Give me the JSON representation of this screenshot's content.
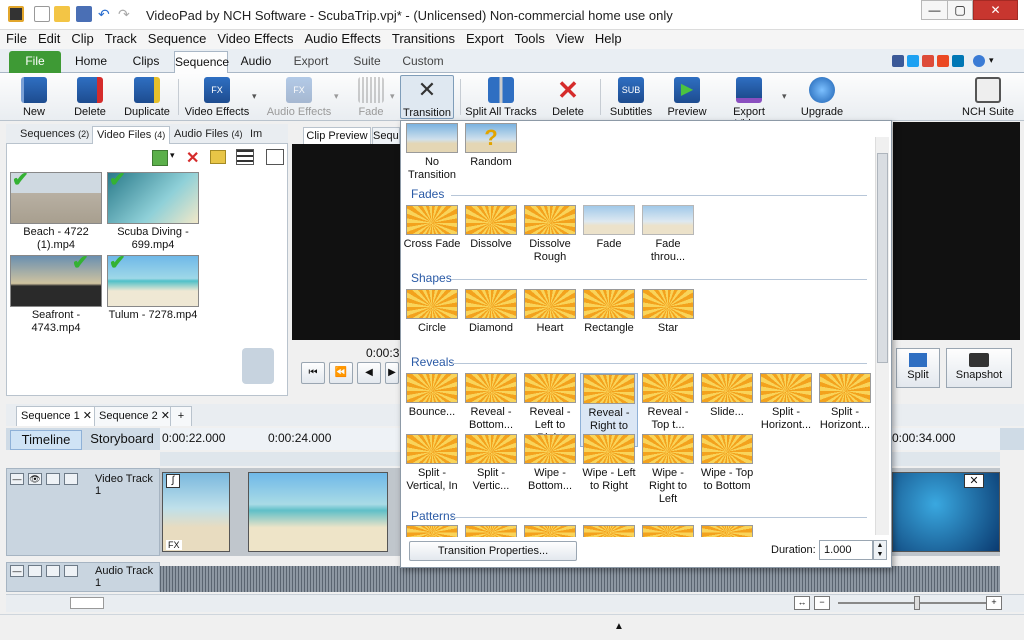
{
  "window": {
    "title": "VideoPad by NCH Software - ScubaTrip.vpj* - (Unlicensed) Non-commercial home use only",
    "minimize": "—",
    "maximize": "▢",
    "close": "✕"
  },
  "menu": [
    "File",
    "Edit",
    "Clip",
    "Track",
    "Sequence",
    "Video Effects",
    "Audio Effects",
    "Transitions",
    "Export",
    "Tools",
    "View",
    "Help"
  ],
  "ribbon_tabs": [
    "File",
    "Home",
    "Clips",
    "Sequence",
    "Audio",
    "Export",
    "Suite",
    "Custom"
  ],
  "toolbar": {
    "new": "New",
    "delete": "Delete",
    "duplicate": "Duplicate",
    "video_effects": "Video Effects",
    "audio_effects": "Audio Effects",
    "fade": "Fade",
    "transition": "Transition",
    "split_all_tracks": "Split All Tracks",
    "delete2": "Delete",
    "subtitles": "Subtitles",
    "preview": "Preview",
    "export_video": "Export Video",
    "upgrade": "Upgrade",
    "nch_suite": "NCH Suite",
    "sub_badge": "SUB",
    "fx_badge": "FX"
  },
  "bin": {
    "tabs": [
      {
        "label": "Sequences",
        "count": "(2)"
      },
      {
        "label": "Video Files",
        "count": "(4)"
      },
      {
        "label": "Audio Files",
        "count": "(4)"
      },
      {
        "label": "Im",
        "count": ""
      }
    ],
    "files": [
      {
        "name": "Beach - 4722 (1).mp4"
      },
      {
        "name": "Scuba Diving - 699.mp4"
      },
      {
        "name": "Seafront - 4743.mp4"
      },
      {
        "name": "Tulum - 7278.mp4"
      }
    ]
  },
  "preview": {
    "tab_clip": "Clip Preview",
    "tab_seq": "Seque",
    "timecode": "0:00:3",
    "split": "Split",
    "snapshot": "Snapshot"
  },
  "sequences": {
    "tabs": [
      "Sequence 1",
      "Sequence 2"
    ],
    "add": "+",
    "timeline": "Timeline",
    "storyboard": "Storyboard",
    "ruler": [
      "0:00:22.000",
      "0:00:24.000",
      "0:00:34.000"
    ],
    "video_track": "Video Track 1",
    "audio_track": "Audio Track 1",
    "fx": "FX"
  },
  "transition_popup": {
    "top": [
      {
        "label": "No Transition"
      },
      {
        "label": "Random"
      }
    ],
    "groups": [
      {
        "name": "Fades",
        "items": [
          "Cross Fade",
          "Dissolve",
          "Dissolve Rough",
          "Fade",
          "Fade throu..."
        ]
      },
      {
        "name": "Shapes",
        "items": [
          "Circle",
          "Diamond",
          "Heart",
          "Rectangle",
          "Star"
        ]
      },
      {
        "name": "Reveals",
        "items": [
          "Bounce...",
          "Reveal - Bottom...",
          "Reveal - Left to Right",
          "Reveal - Right to Left",
          "Reveal - Top t...",
          "Slide...",
          "Split - Horizont...",
          "Split - Horizont...",
          "Split - Vertical, In",
          "Split - Vertic...",
          "Wipe - Bottom...",
          "Wipe - Left to Right",
          "Wipe - Right to Left",
          "Wipe - Top to Bottom"
        ]
      },
      {
        "name": "Patterns",
        "items": []
      }
    ],
    "selected": "Reveal - Right to Left",
    "properties_button": "Transition Properties...",
    "duration_label": "Duration:",
    "duration_value": "1.000"
  },
  "colors": {
    "accent": "#2a5aa6",
    "file_tab": "#3e9a35",
    "check": "#34b233"
  }
}
